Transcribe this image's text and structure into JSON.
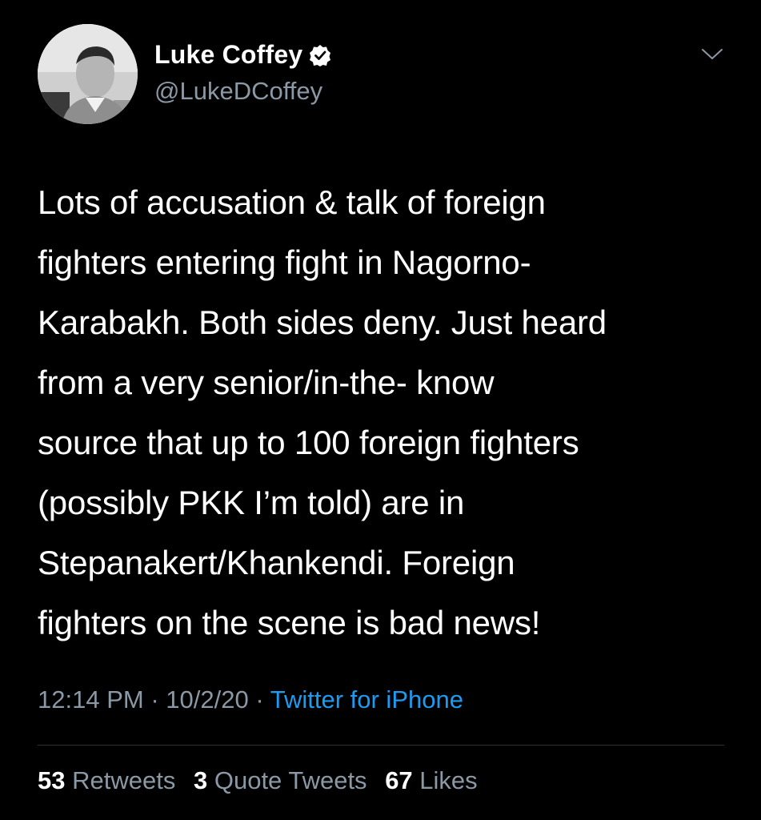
{
  "author": {
    "display_name": "Luke Coffey",
    "handle": "@LukeDCoffey",
    "verified": true,
    "avatar_icon": "profile-photo"
  },
  "tweet": {
    "text": "Lots of accusation & talk of foreign\nfighters entering fight in Nagorno-\nKarabakh. Both sides deny. Just heard\nfrom a very senior/in-the- know\nsource that up to 100 foreign fighters\n(possibly PKK I’m told) are in\nStepanakert/Khankendi. Foreign\nfighters on the scene is bad news!",
    "time": "12:14 PM",
    "date": "10/2/20",
    "separator": "·",
    "source": "Twitter for iPhone"
  },
  "stats": {
    "retweets_count": "53",
    "retweets_label": "Retweets",
    "quotes_count": "3",
    "quotes_label": "Quote Tweets",
    "likes_count": "67",
    "likes_label": "Likes"
  },
  "colors": {
    "background": "#000000",
    "primary_text": "#ffffff",
    "secondary_text": "#8b98a5",
    "accent": "#1d9bf0",
    "divider": "#2f3336"
  }
}
